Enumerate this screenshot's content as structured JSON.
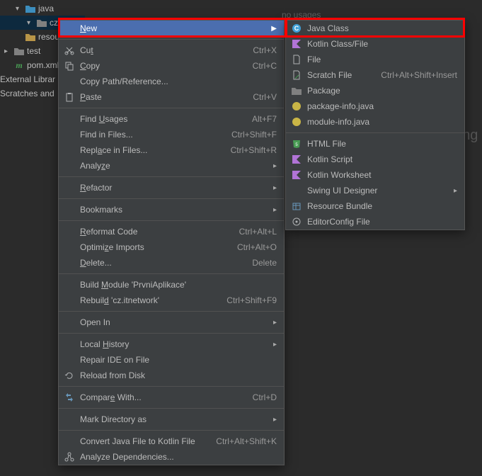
{
  "editor": {
    "no_usages": "no usages"
  },
  "tree": {
    "java": "java",
    "cz": "cz",
    "resources": "resou",
    "test": "test",
    "pom": "pom.xml",
    "external": "External Librar",
    "scratches": "Scratches and"
  },
  "ctx": {
    "new": "New",
    "cut": {
      "l": "Cut",
      "s": "Ctrl+X"
    },
    "copy": {
      "l": "Copy",
      "s": "Ctrl+C"
    },
    "copypath": "Copy Path/Reference...",
    "paste": {
      "l": "Paste",
      "s": "Ctrl+V"
    },
    "findusages": {
      "l": "Find Usages",
      "s": "Alt+F7"
    },
    "findfiles": {
      "l": "Find in Files...",
      "s": "Ctrl+Shift+F"
    },
    "replacefiles": {
      "l": "Replace in Files...",
      "s": "Ctrl+Shift+R"
    },
    "analyze": "Analyze",
    "refactor": "Refactor",
    "bookmarks": "Bookmarks",
    "reformat": {
      "l": "Reformat Code",
      "s": "Ctrl+Alt+L"
    },
    "optimize": {
      "l": "Optimize Imports",
      "s": "Ctrl+Alt+O"
    },
    "delete": {
      "l": "Delete...",
      "s": "Delete"
    },
    "build": "Build Module 'PrvniAplikace'",
    "rebuild": {
      "l": "Rebuild 'cz.itnetwork'",
      "s": "Ctrl+Shift+F9"
    },
    "openin": "Open In",
    "history": "Local History",
    "repair": "Repair IDE on File",
    "reload": "Reload from Disk",
    "compare": {
      "l": "Compare With...",
      "s": "Ctrl+D"
    },
    "markdir": "Mark Directory as",
    "convert": {
      "l": "Convert Java File to Kotlin File",
      "s": "Ctrl+Alt+Shift+K"
    },
    "analyzedeps": "Analyze Dependencies..."
  },
  "sub": {
    "javaclass": "Java Class",
    "kotlin": "Kotlin Class/File",
    "file": "File",
    "scratch": {
      "l": "Scratch File",
      "s": "Ctrl+Alt+Shift+Insert"
    },
    "package": "Package",
    "pkginfo": "package-info.java",
    "modinfo": "module-info.java",
    "html": "HTML File",
    "kscript": "Kotlin Script",
    "kwork": "Kotlin Worksheet",
    "swing": "Swing UI Designer",
    "resbundle": "Resource Bundle",
    "editorconfig": "EditorConfig File"
  }
}
